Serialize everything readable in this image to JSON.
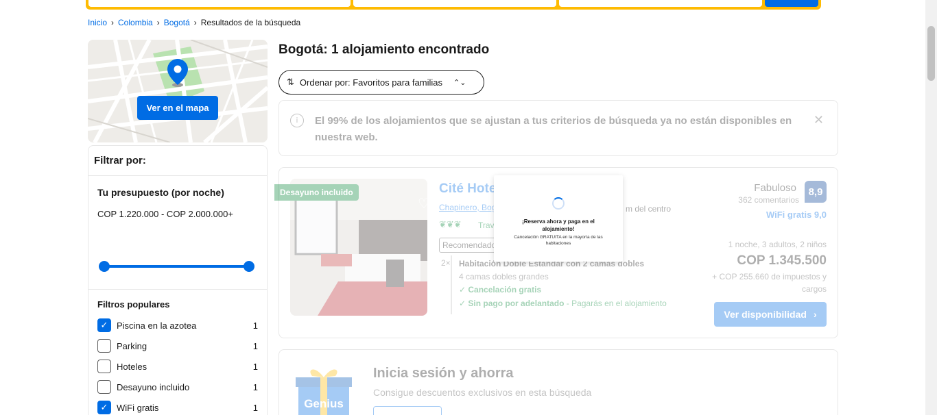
{
  "breadcrumb": {
    "items": [
      "Inicio",
      "Colombia",
      "Bogotá"
    ],
    "current": "Resultados de la búsqueda"
  },
  "map": {
    "button_label": "Ver en el mapa"
  },
  "filters": {
    "title": "Filtrar por:",
    "budget_title": "Tu presupuesto (por noche)",
    "budget_range": "COP 1.220.000 - COP 2.000.000+",
    "popular_title": "Filtros populares",
    "items": [
      {
        "label": "Piscina en la azotea",
        "count": "1",
        "checked": true
      },
      {
        "label": "Parking",
        "count": "1",
        "checked": false
      },
      {
        "label": "Hoteles",
        "count": "1",
        "checked": false
      },
      {
        "label": "Desayuno incluido",
        "count": "1",
        "checked": false
      },
      {
        "label": "WiFi gratis",
        "count": "1",
        "checked": true
      }
    ]
  },
  "results": {
    "title": "Bogotá: 1 alojamiento encontrado",
    "sort_label": "Ordenar por: Favoritos para familias",
    "notice": "El 99% de los alojamientos que se ajustan a tus criterios de búsqueda ya no están disponibles en nuestra web."
  },
  "hotel": {
    "ribbon": "Desayuno incluido",
    "name": "Cité Hote",
    "location": "Chapinero, Bog",
    "distance": "m del centro",
    "travel": "Trave",
    "recommended": "Recomendado",
    "qty": "2×",
    "room_name": "Habitación Doble Estándar con 2 camas dobles",
    "room_beds": "4 camas dobles grandes",
    "perk1": "Cancelación gratis",
    "perk2": "Sin pago por adelantado",
    "perk2_rest": " - Pagarás en el alojamiento",
    "score_label": "Fabuloso",
    "reviews": "362 comentarios",
    "score": "8,9",
    "wifi": "WiFi gratis 9,0",
    "stay": "1 noche, 3 adultos, 2 niños",
    "price": "COP 1.345.500",
    "taxes": "+ COP 255.660 de impuestos y cargos",
    "button_label": "Ver disponibilidad"
  },
  "loader": {
    "title": "¡Reserva ahora y paga en el alojamiento!",
    "subtitle": "Cancelación GRATUITA en la mayoría de las habitaciones"
  },
  "genius": {
    "brand": "Genius",
    "title": "Inicia sesión y ahorra",
    "subtitle": "Consigue descuentos exclusivos en esta búsqueda"
  },
  "colors": {
    "brand_blue": "#006ce4",
    "accent_yellow": "#febb02",
    "green": "#008234",
    "score_navy": "#003b95"
  }
}
